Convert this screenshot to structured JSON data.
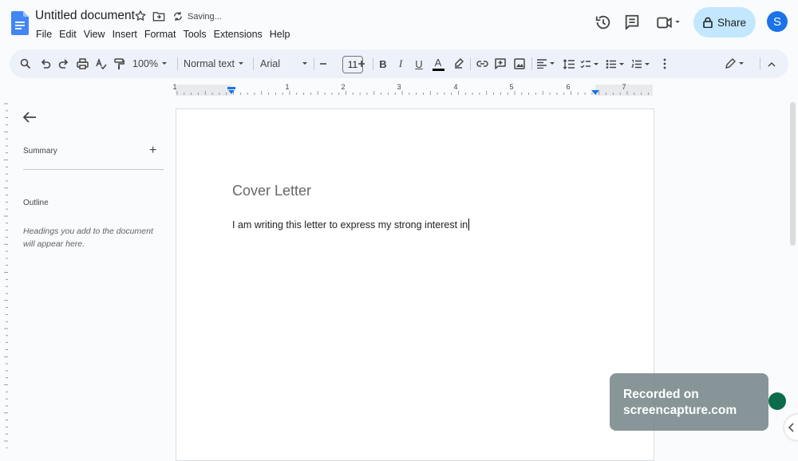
{
  "header": {
    "doc_title": "Untitled document",
    "status": "Saving...",
    "menus": [
      "File",
      "Edit",
      "View",
      "Insert",
      "Format",
      "Tools",
      "Extensions",
      "Help"
    ],
    "share_label": "Share",
    "avatar_letter": "S"
  },
  "toolbar": {
    "zoom": "100%",
    "style": "Normal text",
    "font": "Arial",
    "font_size": "11",
    "bold": "B",
    "italic": "I",
    "underline": "U",
    "text_color": "A"
  },
  "ruler": {
    "numbers": [
      "1",
      "1",
      "2",
      "3",
      "4",
      "5",
      "6",
      "7"
    ]
  },
  "sidebar": {
    "summary_label": "Summary",
    "outline_label": "Outline",
    "outline_hint": "Headings you add to the document will appear here."
  },
  "document": {
    "heading": "Cover Letter",
    "body": "I am writing this letter to express my strong interest in"
  },
  "watermark": {
    "line1": "Recorded on",
    "line2": "screencapture.com"
  },
  "colors": {
    "accent": "#1a73e8",
    "share_bg": "#c2e7ff",
    "toolbar_bg": "#edf2fa"
  }
}
